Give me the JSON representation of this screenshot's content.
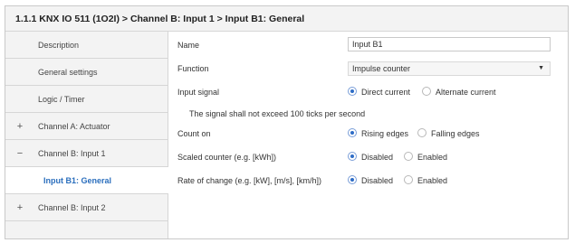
{
  "window": {
    "title": "1.1.1 KNX IO 511 (1O2I) > Channel B: Input 1 > Input B1: General"
  },
  "sidebar": {
    "items": [
      {
        "prefix": "",
        "label": "Description"
      },
      {
        "prefix": "",
        "label": "General settings"
      },
      {
        "prefix": "",
        "label": "Logic / Timer"
      },
      {
        "prefix": "+",
        "label": "Channel A: Actuator"
      },
      {
        "prefix": "−",
        "label": "Channel B: Input 1"
      },
      {
        "prefix": "",
        "label": "Input B1: General"
      },
      {
        "prefix": "+",
        "label": "Channel B: Input 2"
      }
    ]
  },
  "form": {
    "name": {
      "label": "Name",
      "value": "Input B1"
    },
    "function": {
      "label": "Function",
      "value": "Impulse counter",
      "icon": "chevron-down-icon"
    },
    "input_signal": {
      "label": "Input signal",
      "options": [
        "Direct current",
        "Alternate current"
      ],
      "selected": "Direct current"
    },
    "note": "The signal shall not exceed 100 ticks per second",
    "count_on": {
      "label": "Count on",
      "options": [
        "Rising edges",
        "Falling edges"
      ],
      "selected": "Rising edges"
    },
    "scaled_counter": {
      "label": "Scaled counter (e.g. [kWh])",
      "options": [
        "Disabled",
        "Enabled"
      ],
      "selected": "Disabled"
    },
    "rate_of_change": {
      "label": "Rate of change (e.g. [kW], [m/s], [km/h])",
      "options": [
        "Disabled",
        "Enabled"
      ],
      "selected": "Disabled"
    }
  },
  "colors": {
    "accent": "#2d6cc6",
    "active_nav_text": "#2a6ebd",
    "sidebar_bg": "#f3f3f3"
  }
}
